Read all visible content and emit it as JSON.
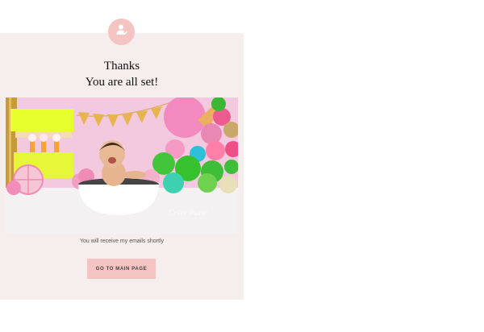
{
  "header": {
    "icon": "user-check-icon",
    "title_line1": "Thanks",
    "title_line2": "You are all set!"
  },
  "photo": {
    "description_icon": "photo-image",
    "watermark": "Color Pulse"
  },
  "note": "You will receive my emails shortly",
  "cta": {
    "label": "GO TO MAIN PAGE"
  },
  "colors": {
    "card_bg": "#f6eded",
    "accent": "#f4c4c3",
    "text": "#111111"
  }
}
